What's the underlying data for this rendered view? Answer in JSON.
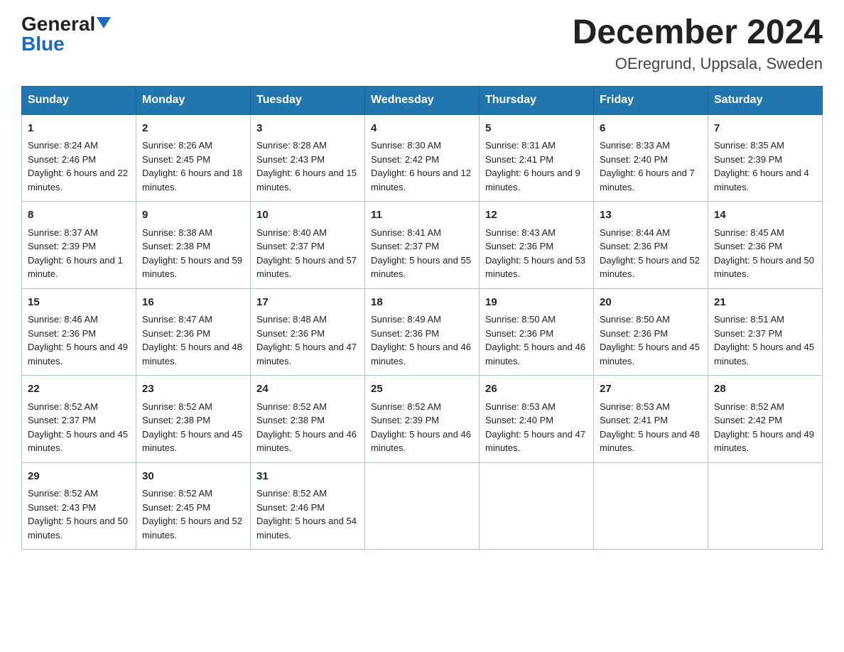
{
  "header": {
    "logo_general": "General",
    "logo_blue": "Blue",
    "month_title": "December 2024",
    "location": "OEregrund, Uppsala, Sweden"
  },
  "weekdays": [
    "Sunday",
    "Monday",
    "Tuesday",
    "Wednesday",
    "Thursday",
    "Friday",
    "Saturday"
  ],
  "weeks": [
    [
      {
        "day": "1",
        "sunrise": "Sunrise: 8:24 AM",
        "sunset": "Sunset: 2:46 PM",
        "daylight": "Daylight: 6 hours and 22 minutes."
      },
      {
        "day": "2",
        "sunrise": "Sunrise: 8:26 AM",
        "sunset": "Sunset: 2:45 PM",
        "daylight": "Daylight: 6 hours and 18 minutes."
      },
      {
        "day": "3",
        "sunrise": "Sunrise: 8:28 AM",
        "sunset": "Sunset: 2:43 PM",
        "daylight": "Daylight: 6 hours and 15 minutes."
      },
      {
        "day": "4",
        "sunrise": "Sunrise: 8:30 AM",
        "sunset": "Sunset: 2:42 PM",
        "daylight": "Daylight: 6 hours and 12 minutes."
      },
      {
        "day": "5",
        "sunrise": "Sunrise: 8:31 AM",
        "sunset": "Sunset: 2:41 PM",
        "daylight": "Daylight: 6 hours and 9 minutes."
      },
      {
        "day": "6",
        "sunrise": "Sunrise: 8:33 AM",
        "sunset": "Sunset: 2:40 PM",
        "daylight": "Daylight: 6 hours and 7 minutes."
      },
      {
        "day": "7",
        "sunrise": "Sunrise: 8:35 AM",
        "sunset": "Sunset: 2:39 PM",
        "daylight": "Daylight: 6 hours and 4 minutes."
      }
    ],
    [
      {
        "day": "8",
        "sunrise": "Sunrise: 8:37 AM",
        "sunset": "Sunset: 2:39 PM",
        "daylight": "Daylight: 6 hours and 1 minute."
      },
      {
        "day": "9",
        "sunrise": "Sunrise: 8:38 AM",
        "sunset": "Sunset: 2:38 PM",
        "daylight": "Daylight: 5 hours and 59 minutes."
      },
      {
        "day": "10",
        "sunrise": "Sunrise: 8:40 AM",
        "sunset": "Sunset: 2:37 PM",
        "daylight": "Daylight: 5 hours and 57 minutes."
      },
      {
        "day": "11",
        "sunrise": "Sunrise: 8:41 AM",
        "sunset": "Sunset: 2:37 PM",
        "daylight": "Daylight: 5 hours and 55 minutes."
      },
      {
        "day": "12",
        "sunrise": "Sunrise: 8:43 AM",
        "sunset": "Sunset: 2:36 PM",
        "daylight": "Daylight: 5 hours and 53 minutes."
      },
      {
        "day": "13",
        "sunrise": "Sunrise: 8:44 AM",
        "sunset": "Sunset: 2:36 PM",
        "daylight": "Daylight: 5 hours and 52 minutes."
      },
      {
        "day": "14",
        "sunrise": "Sunrise: 8:45 AM",
        "sunset": "Sunset: 2:36 PM",
        "daylight": "Daylight: 5 hours and 50 minutes."
      }
    ],
    [
      {
        "day": "15",
        "sunrise": "Sunrise: 8:46 AM",
        "sunset": "Sunset: 2:36 PM",
        "daylight": "Daylight: 5 hours and 49 minutes."
      },
      {
        "day": "16",
        "sunrise": "Sunrise: 8:47 AM",
        "sunset": "Sunset: 2:36 PM",
        "daylight": "Daylight: 5 hours and 48 minutes."
      },
      {
        "day": "17",
        "sunrise": "Sunrise: 8:48 AM",
        "sunset": "Sunset: 2:36 PM",
        "daylight": "Daylight: 5 hours and 47 minutes."
      },
      {
        "day": "18",
        "sunrise": "Sunrise: 8:49 AM",
        "sunset": "Sunset: 2:36 PM",
        "daylight": "Daylight: 5 hours and 46 minutes."
      },
      {
        "day": "19",
        "sunrise": "Sunrise: 8:50 AM",
        "sunset": "Sunset: 2:36 PM",
        "daylight": "Daylight: 5 hours and 46 minutes."
      },
      {
        "day": "20",
        "sunrise": "Sunrise: 8:50 AM",
        "sunset": "Sunset: 2:36 PM",
        "daylight": "Daylight: 5 hours and 45 minutes."
      },
      {
        "day": "21",
        "sunrise": "Sunrise: 8:51 AM",
        "sunset": "Sunset: 2:37 PM",
        "daylight": "Daylight: 5 hours and 45 minutes."
      }
    ],
    [
      {
        "day": "22",
        "sunrise": "Sunrise: 8:52 AM",
        "sunset": "Sunset: 2:37 PM",
        "daylight": "Daylight: 5 hours and 45 minutes."
      },
      {
        "day": "23",
        "sunrise": "Sunrise: 8:52 AM",
        "sunset": "Sunset: 2:38 PM",
        "daylight": "Daylight: 5 hours and 45 minutes."
      },
      {
        "day": "24",
        "sunrise": "Sunrise: 8:52 AM",
        "sunset": "Sunset: 2:38 PM",
        "daylight": "Daylight: 5 hours and 46 minutes."
      },
      {
        "day": "25",
        "sunrise": "Sunrise: 8:52 AM",
        "sunset": "Sunset: 2:39 PM",
        "daylight": "Daylight: 5 hours and 46 minutes."
      },
      {
        "day": "26",
        "sunrise": "Sunrise: 8:53 AM",
        "sunset": "Sunset: 2:40 PM",
        "daylight": "Daylight: 5 hours and 47 minutes."
      },
      {
        "day": "27",
        "sunrise": "Sunrise: 8:53 AM",
        "sunset": "Sunset: 2:41 PM",
        "daylight": "Daylight: 5 hours and 48 minutes."
      },
      {
        "day": "28",
        "sunrise": "Sunrise: 8:52 AM",
        "sunset": "Sunset: 2:42 PM",
        "daylight": "Daylight: 5 hours and 49 minutes."
      }
    ],
    [
      {
        "day": "29",
        "sunrise": "Sunrise: 8:52 AM",
        "sunset": "Sunset: 2:43 PM",
        "daylight": "Daylight: 5 hours and 50 minutes."
      },
      {
        "day": "30",
        "sunrise": "Sunrise: 8:52 AM",
        "sunset": "Sunset: 2:45 PM",
        "daylight": "Daylight: 5 hours and 52 minutes."
      },
      {
        "day": "31",
        "sunrise": "Sunrise: 8:52 AM",
        "sunset": "Sunset: 2:46 PM",
        "daylight": "Daylight: 5 hours and 54 minutes."
      },
      null,
      null,
      null,
      null
    ]
  ]
}
